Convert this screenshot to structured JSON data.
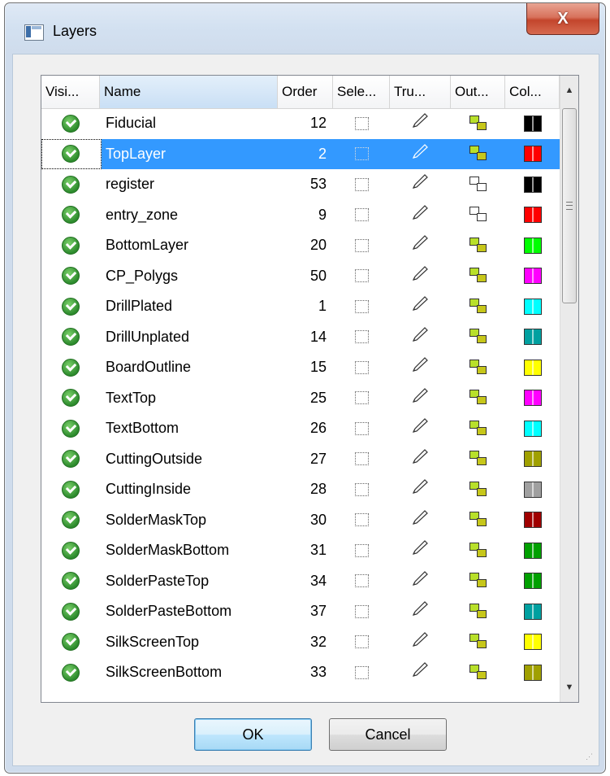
{
  "window": {
    "title": "Layers",
    "close_label": "X"
  },
  "table": {
    "columns": [
      "Visi...",
      "Name",
      "Order",
      "Sele...",
      "Tru...",
      "Out...",
      "Col..."
    ],
    "rows": [
      {
        "name": "Fiducial",
        "order": "12",
        "outline": "filled",
        "color": "#000000",
        "selected": false
      },
      {
        "name": "TopLayer",
        "order": "2",
        "outline": "filled",
        "color": "#ff0000",
        "selected": true
      },
      {
        "name": "register",
        "order": "53",
        "outline": "empty",
        "color": "#000000",
        "selected": false
      },
      {
        "name": "entry_zone",
        "order": "9",
        "outline": "empty",
        "color": "#ff0000",
        "selected": false
      },
      {
        "name": "BottomLayer",
        "order": "20",
        "outline": "filled",
        "color": "#00ff00",
        "selected": false
      },
      {
        "name": "CP_Polygs",
        "order": "50",
        "outline": "filled",
        "color": "#ff00ff",
        "selected": false
      },
      {
        "name": "DrillPlated",
        "order": "1",
        "outline": "filled",
        "color": "#00ffff",
        "selected": false
      },
      {
        "name": "DrillUnplated",
        "order": "14",
        "outline": "filled",
        "color": "#00a0a0",
        "selected": false
      },
      {
        "name": "BoardOutline",
        "order": "15",
        "outline": "filled",
        "color": "#ffff00",
        "selected": false
      },
      {
        "name": "TextTop",
        "order": "25",
        "outline": "filled",
        "color": "#ff00ff",
        "selected": false
      },
      {
        "name": "TextBottom",
        "order": "26",
        "outline": "filled",
        "color": "#00ffff",
        "selected": false
      },
      {
        "name": "CuttingOutside",
        "order": "27",
        "outline": "filled",
        "color": "#a0a000",
        "selected": false
      },
      {
        "name": "CuttingInside",
        "order": "28",
        "outline": "filled",
        "color": "#a0a0a0",
        "selected": false
      },
      {
        "name": "SolderMaskTop",
        "order": "30",
        "outline": "filled",
        "color": "#a00000",
        "selected": false
      },
      {
        "name": "SolderMaskBottom",
        "order": "31",
        "outline": "filled",
        "color": "#00a000",
        "selected": false
      },
      {
        "name": "SolderPasteTop",
        "order": "34",
        "outline": "filled",
        "color": "#00a000",
        "selected": false
      },
      {
        "name": "SolderPasteBottom",
        "order": "37",
        "outline": "filled",
        "color": "#00a0a0",
        "selected": false
      },
      {
        "name": "SilkScreenTop",
        "order": "32",
        "outline": "filled",
        "color": "#ffff00",
        "selected": false
      },
      {
        "name": "SilkScreenBottom",
        "order": "33",
        "outline": "filled",
        "color": "#a0a000",
        "selected": false
      }
    ]
  },
  "buttons": {
    "ok": "OK",
    "cancel": "Cancel"
  }
}
